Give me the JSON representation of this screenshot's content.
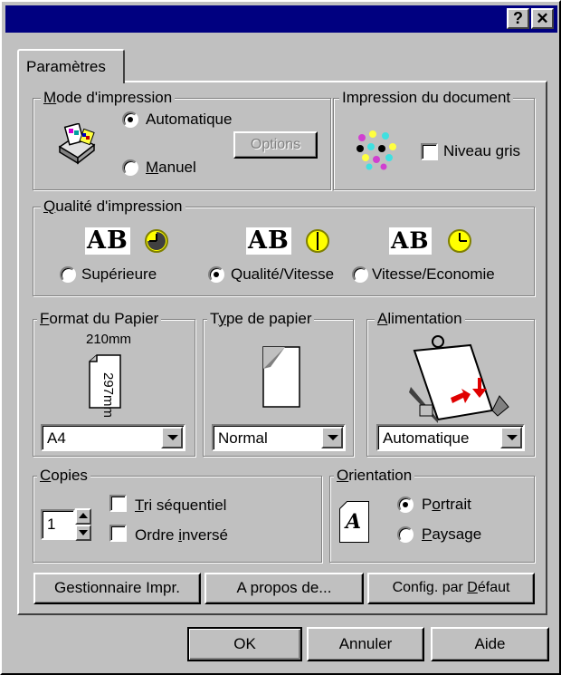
{
  "window": {
    "help_label": "?",
    "close_label": "✕"
  },
  "tab": {
    "label": "Paramètres"
  },
  "print_mode": {
    "title_u": "M",
    "title_rest": "ode d'impression",
    "automatic": "Automatique",
    "manual_u": "M",
    "manual_rest": "anuel",
    "options_button": "Options",
    "selected": "Automatique"
  },
  "document_print": {
    "title": "Impression du document",
    "grayscale": "Niveau gris",
    "grayscale_checked": false
  },
  "quality": {
    "title_u": "Q",
    "title_rest": "ualité d'impression",
    "options": [
      "Supérieure",
      "Qualité/Vitesse",
      "Vitesse/Economie"
    ],
    "selected": "Qualité/Vitesse",
    "sample_text": "AB"
  },
  "paper_format": {
    "title_u": "F",
    "title_rest": "ormat du Papier",
    "width_label": "210mm",
    "height_label": "297mm",
    "value": "A4"
  },
  "paper_type": {
    "title_pre": "T",
    "title_u": "y",
    "title_rest": "pe de papier",
    "value": "Normal"
  },
  "feed": {
    "title_u": "A",
    "title_rest": "limentation",
    "value": "Automatique"
  },
  "copies": {
    "title_u": "C",
    "title_rest": "opies",
    "count": "1",
    "collate_u": "T",
    "collate_rest": "ri séquentiel",
    "reverse_pre": "Ordre ",
    "reverse_u": "i",
    "reverse_rest": "nversé"
  },
  "orientation": {
    "title_u": "O",
    "title_rest": "rientation",
    "icon_letter": "A",
    "portrait_pre": "P",
    "portrait_u": "o",
    "portrait_rest": "rtrait",
    "landscape_u": "P",
    "landscape_rest": "aysage",
    "selected": "Portrait"
  },
  "tab_buttons": {
    "printer_manager": "Gestionnaire Impr.",
    "about": "A propos de...",
    "defaults_pre": "Config. par ",
    "defaults_u": "D",
    "defaults_rest": "éfaut"
  },
  "dialog_buttons": {
    "ok": "OK",
    "cancel": "Annuler",
    "help": "Aide"
  }
}
